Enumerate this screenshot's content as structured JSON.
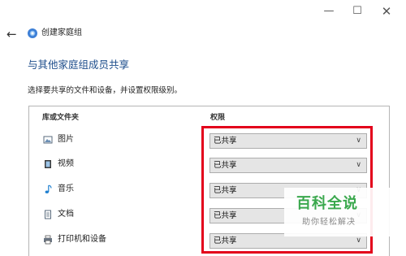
{
  "window": {
    "controls": {
      "minimize": "—",
      "maximize": "☐",
      "close": "✕"
    }
  },
  "nav": {
    "back": "←",
    "title": "创建家庭组",
    "icon": "homegroup-icon"
  },
  "heading": "与其他家庭组成员共享",
  "subtitle": "选择要共享的文件和设备，并设置权限级别。",
  "table": {
    "col_library": "库或文件夹",
    "col_permission": "权限",
    "rows": [
      {
        "label": "图片",
        "icon": "pictures-icon",
        "permission": "已共享"
      },
      {
        "label": "视频",
        "icon": "videos-icon",
        "permission": "已共享"
      },
      {
        "label": "音乐",
        "icon": "music-icon",
        "permission": "已共享"
      },
      {
        "label": "文档",
        "icon": "documents-icon",
        "permission": "已共享"
      },
      {
        "label": "打印机和设备",
        "icon": "printer-icon",
        "permission": "已共享"
      }
    ]
  },
  "highlight_color": "#e3001b",
  "heading_color": "#1e4e8c",
  "watermark": {
    "title": "百科全说",
    "subtitle": "助你轻松解决",
    "color": "#3aa84d"
  }
}
